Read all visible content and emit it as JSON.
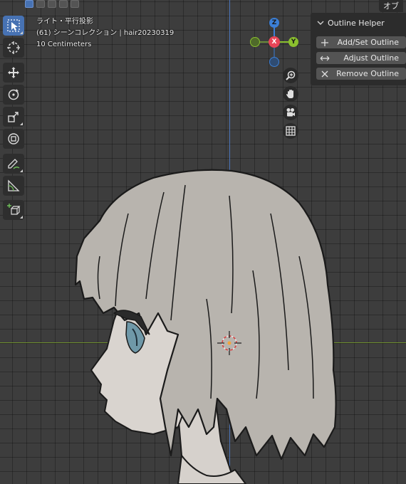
{
  "viewport": {
    "view_name": "ライト・平行投影",
    "collection": "(61) シーンコレクション | hair20230319",
    "scale": "10 Centimeters",
    "background": "#3d3d3d",
    "header_right": "オブ"
  },
  "gizmo": {
    "z_label": "Z",
    "x_label": "X",
    "y_label": "Y",
    "colors": {
      "x": "#e84457",
      "y": "#8bc02e",
      "z": "#3b7fd6"
    }
  },
  "toolbar": {
    "tools": [
      {
        "name": "select-box",
        "icon": "cursor-select-icon",
        "active": true
      },
      {
        "name": "cursor",
        "icon": "cursor-target-icon",
        "active": false
      },
      {
        "name": "move",
        "icon": "move-icon",
        "active": false
      },
      {
        "name": "rotate",
        "icon": "rotate-icon",
        "active": false
      },
      {
        "name": "scale",
        "icon": "scale-icon",
        "active": false
      },
      {
        "name": "transform",
        "icon": "transform-icon",
        "active": false
      },
      {
        "name": "annotate",
        "icon": "annotate-pencil-icon",
        "active": false
      },
      {
        "name": "measure",
        "icon": "ruler-icon",
        "active": false
      },
      {
        "name": "add-cube",
        "icon": "add-cube-icon",
        "active": false
      }
    ]
  },
  "nav_buttons": [
    {
      "name": "zoom",
      "icon": "zoom-icon"
    },
    {
      "name": "pan",
      "icon": "hand-icon"
    },
    {
      "name": "camera",
      "icon": "camera-icon"
    },
    {
      "name": "ortho-grid",
      "icon": "grid-icon"
    }
  ],
  "panel": {
    "title": "Outline Helper",
    "buttons": [
      {
        "icon": "plus-icon",
        "label": "Add/Set Outline"
      },
      {
        "icon": "arrows-horizontal-icon",
        "label": "Adjust Outline"
      },
      {
        "icon": "close-icon",
        "label": "Remove Outline"
      }
    ]
  },
  "colors": {
    "accent": "#4772b3",
    "hair": "#b6b2ac",
    "skin": "#d9d4cf",
    "eye": "#6f98a8",
    "axis_z": "#4a73b8",
    "axis_y": "#6f8f2e"
  }
}
